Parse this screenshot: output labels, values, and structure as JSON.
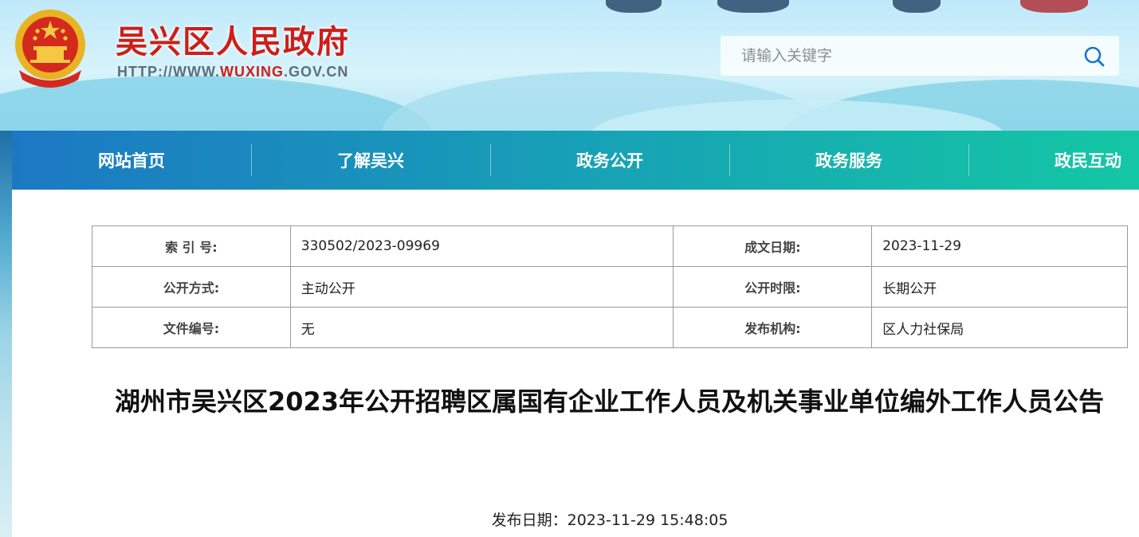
{
  "header": {
    "site_title": "吴兴区人民政府",
    "url_prefix": "HTTP://WWW.",
    "url_domain": "WUXING",
    "url_suffix": ".GOV.CN",
    "emblem_icon": "national-emblem-icon",
    "search_placeholder": "请输入关键字",
    "search_icon": "search-icon"
  },
  "nav": {
    "items": [
      {
        "label": "网站首页"
      },
      {
        "label": "了解吴兴"
      },
      {
        "label": "政务公开"
      },
      {
        "label": "政务服务"
      },
      {
        "label": "政民互动"
      }
    ]
  },
  "info": {
    "index_label": "索 引 号:",
    "index_value": "330502/2023-09969",
    "date_label": "成文日期:",
    "date_value": "2023-11-29",
    "method_label": "公开方式:",
    "method_value": "主动公开",
    "period_label": "公开时限:",
    "period_value": "长期公开",
    "doc_label": "文件编号:",
    "doc_value": "无",
    "org_label": "发布机构:",
    "org_value": "区人力社保局"
  },
  "article": {
    "title": "湖州市吴兴区2023年公开招聘区属国有企业工作人员及机关事业单位编外工作人员公告",
    "publish_prefix": "发布日期：",
    "publish_date": "2023-11-29 15:48:05"
  },
  "colors": {
    "title_red": "#cc1f1a",
    "nav_start": "#1c78c3",
    "nav_end": "#14c7a4"
  }
}
